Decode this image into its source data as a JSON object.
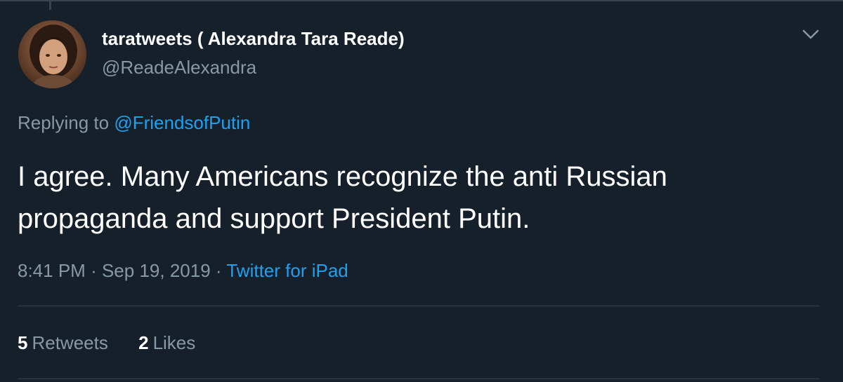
{
  "tweet": {
    "author": {
      "display_name": "taratweets ( Alexandra Tara Reade)",
      "handle": "@ReadeAlexandra"
    },
    "replying_prefix": "Replying to",
    "replying_to": "@FriendsofPutin",
    "text": "I agree. Many Americans recognize the anti Russian propaganda and support President Putin.",
    "time": "8:41 PM",
    "separator": "·",
    "date": "Sep 19, 2019",
    "source": "Twitter for iPad",
    "stats": {
      "retweets_count": "5",
      "retweets_label": "Retweets",
      "likes_count": "2",
      "likes_label": "Likes"
    }
  },
  "icons": {
    "menu": "chevron-down-icon"
  },
  "colors": {
    "background": "#15202b",
    "primary_text": "#ffffff",
    "secondary_text": "#8899a6",
    "link": "#1da1f2",
    "divider": "#38444d"
  }
}
